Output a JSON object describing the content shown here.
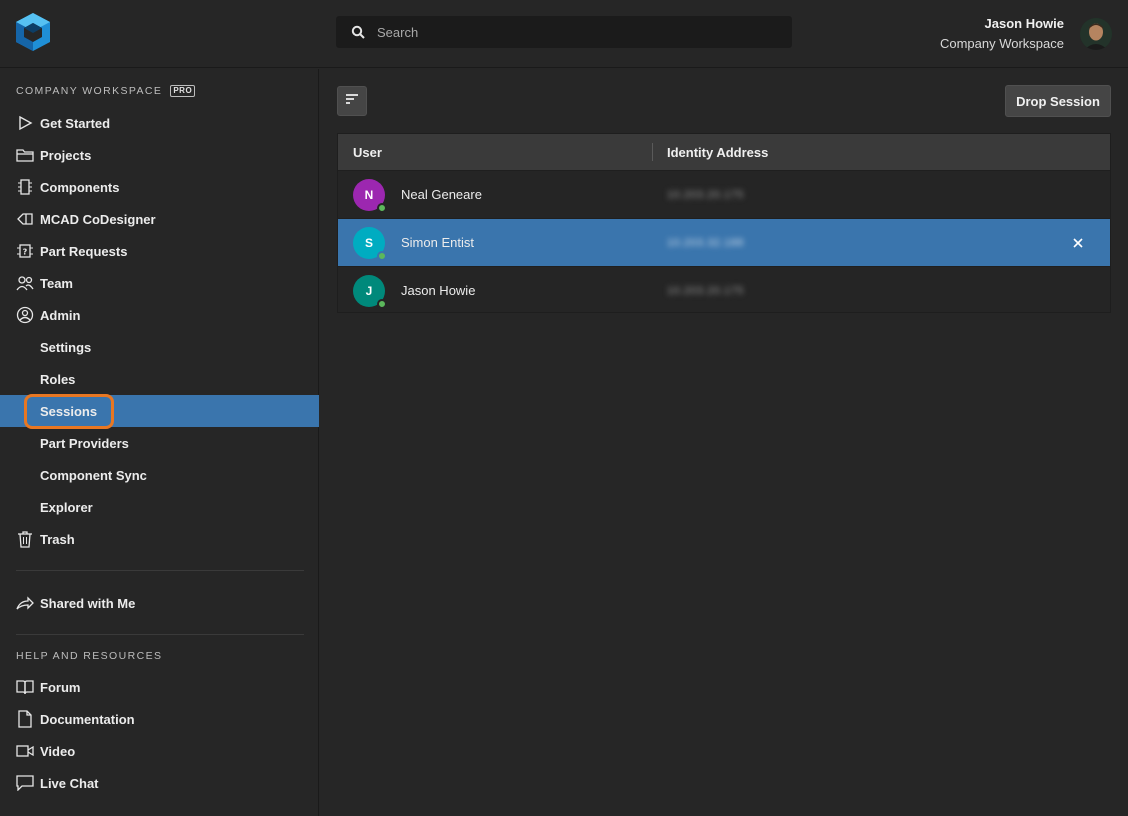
{
  "header": {
    "search": {
      "placeholder": "Search"
    },
    "user": {
      "name": "Jason Howie",
      "workspace": "Company Workspace"
    }
  },
  "sidebar": {
    "workspace_label": "COMPANY WORKSPACE",
    "pro_badge": "PRO",
    "items": [
      {
        "label": "Get Started",
        "icon": "play-icon"
      },
      {
        "label": "Projects",
        "icon": "folder-icon"
      },
      {
        "label": "Components",
        "icon": "chip-icon"
      },
      {
        "label": "MCAD CoDesigner",
        "icon": "mcad-icon"
      },
      {
        "label": "Part Requests",
        "icon": "part-request-icon"
      },
      {
        "label": "Team",
        "icon": "team-icon"
      },
      {
        "label": "Admin",
        "icon": "user-circle-icon"
      }
    ],
    "admin_items": [
      {
        "label": "Settings"
      },
      {
        "label": "Roles"
      },
      {
        "label": "Sessions",
        "active": true
      },
      {
        "label": "Part Providers"
      },
      {
        "label": "Component Sync"
      },
      {
        "label": "Explorer"
      }
    ],
    "trash": {
      "label": "Trash",
      "icon": "trash-icon"
    },
    "shared": {
      "label": "Shared with Me",
      "icon": "share-icon"
    },
    "help_label": "HELP AND RESOURCES",
    "help_items": [
      {
        "label": "Forum",
        "icon": "book-icon"
      },
      {
        "label": "Documentation",
        "icon": "document-icon"
      },
      {
        "label": "Video",
        "icon": "video-icon"
      },
      {
        "label": "Live Chat",
        "icon": "chat-icon"
      }
    ]
  },
  "toolbar": {
    "drop_label": "Drop Session"
  },
  "table": {
    "columns": [
      "User",
      "Identity Address"
    ],
    "rows": [
      {
        "initial": "N",
        "name": "Neal Geneare",
        "ip": "10.203.20.175",
        "color": "#9c27b0",
        "selected": false
      },
      {
        "initial": "S",
        "name": "Simon Entist",
        "ip": "10.203.32.188",
        "color": "#00acc1",
        "selected": true
      },
      {
        "initial": "J",
        "name": "Jason Howie",
        "ip": "10.203.20.175",
        "color": "#00897b",
        "selected": false
      }
    ]
  },
  "colors": {
    "accent": "#3a75ad",
    "highlight": "#e87722",
    "online": "#5cb85c"
  }
}
